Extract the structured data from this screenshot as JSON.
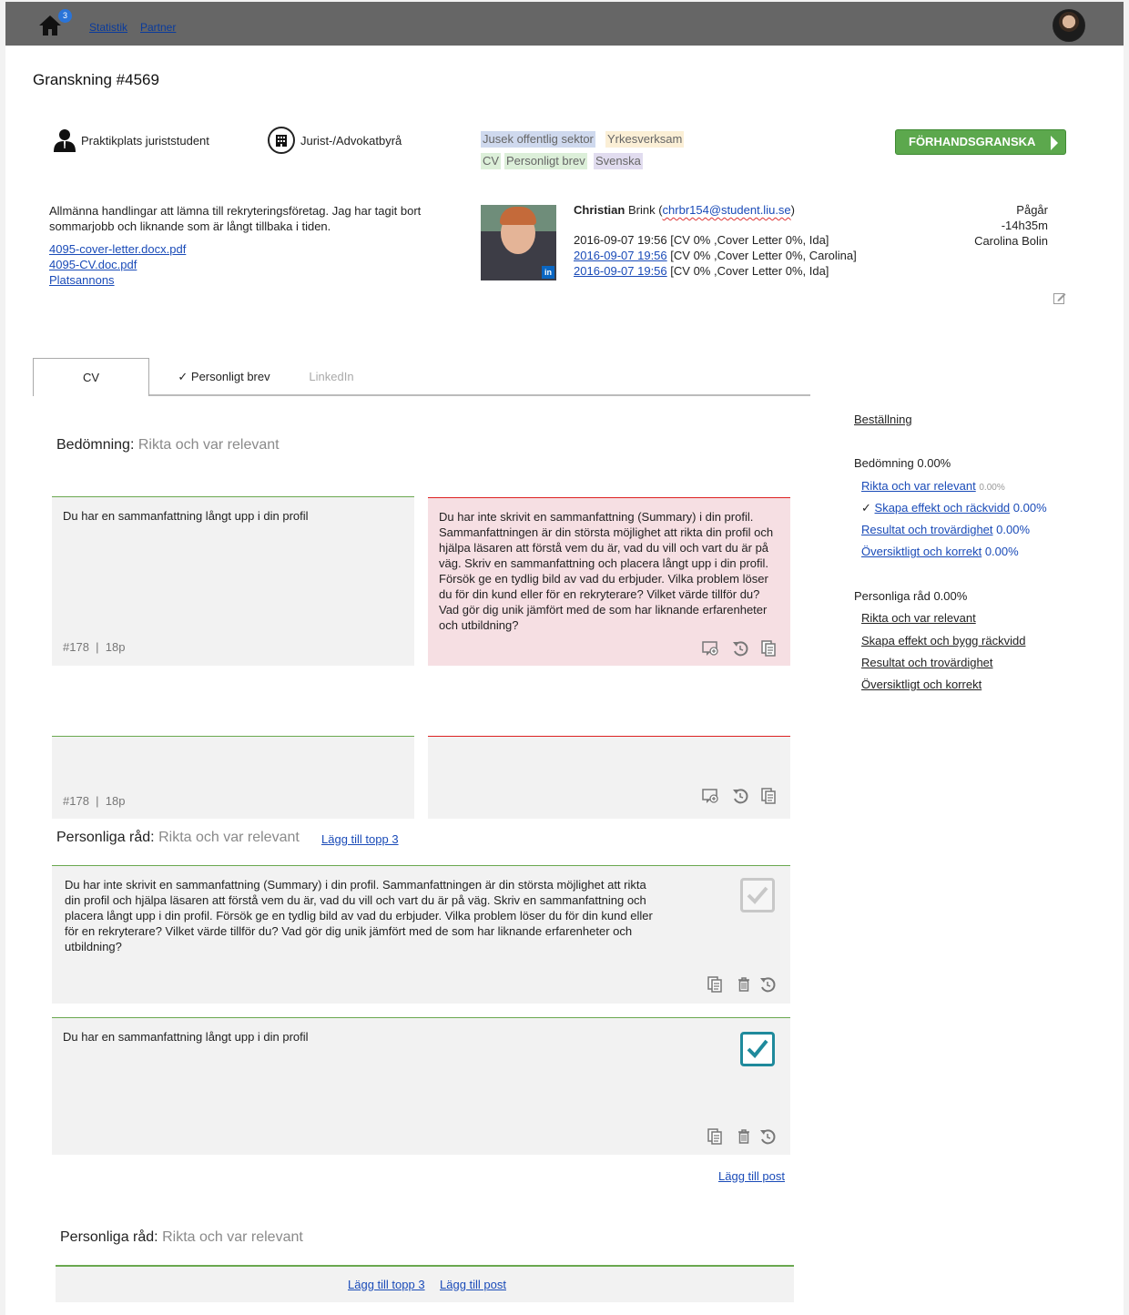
{
  "topbar": {
    "badge_count": "3",
    "nav": [
      "Statistik",
      "Partner"
    ]
  },
  "page_title": "Granskning #4569",
  "info": {
    "position": "Praktikplats juriststudent",
    "industry": "Jurist-/Advokatbyrå",
    "tags": [
      {
        "label": "Jusek offentlig sektor",
        "color": "#cfd9ee"
      },
      {
        "label": "Yrkesverksam",
        "color": "#fbefd6"
      },
      {
        "label": "CV",
        "color": "#dcefd9"
      },
      {
        "label": "Personligt brev",
        "color": "#dcefd9"
      },
      {
        "label": "Svenska",
        "color": "#e1dcef"
      }
    ],
    "preview_button": "FÖRHANDSGRANSKA",
    "description": "Allmänna handlingar att lämna till rekryteringsföretag. Jag har tagit bort sommarjobb och liknande som är långt tillbaka i tiden.",
    "files": [
      "4095-cover-letter.docx.pdf",
      "4095-CV.doc.pdf",
      "Platsannons"
    ],
    "candidate": {
      "first_name": "Christian",
      "last_name": "Brink",
      "email": "chrbr154@student.liu.se"
    },
    "history": [
      {
        "date": "2016-09-07 19:56",
        "linked": false,
        "details": "[CV 0% ,Cover Letter 0%, Ida]"
      },
      {
        "date": "2016-09-07 19:56",
        "linked": true,
        "details": "[CV 0% ,Cover Letter 0%, Carolina]"
      },
      {
        "date": "2016-09-07 19:56",
        "linked": true,
        "details": "[CV 0% ,Cover Letter 0%, Ida]"
      }
    ],
    "status": "Pågår",
    "time_left": "-14h35m",
    "reviewer": "Carolina Bolin"
  },
  "tabs": [
    {
      "label": "CV",
      "state": "active"
    },
    {
      "label": "✓ Personligt brev",
      "state": "normal"
    },
    {
      "label": "LinkedIn",
      "state": "disabled"
    }
  ],
  "assessment": {
    "heading": "Bedömning:",
    "category": "Rikta och var relevant",
    "rows": [
      {
        "left_text": "Du har en sammanfattning långt upp i din profil",
        "left_id": "#178",
        "left_points": "18p",
        "right_text": "Du har inte skrivit en sammanfattning (Summary) i din profil. Sammanfattningen är din största möjlighet att rikta din profil och hjälpa läsaren att förstå vem du är, vad du vill och vart du är på väg. Skriv en sammanfattning och placera långt upp i din profil. Försök ge en tydlig bild av vad du erbjuder. Vilka problem löser du för din kund eller för en rekryterare? Vilket värde tillför du? Vad gör dig unik jämfört med de som har liknande erfarenheter och utbildning?"
      },
      {
        "left_text": "",
        "left_id": "#178",
        "left_points": "18p",
        "right_text": ""
      }
    ]
  },
  "advice": {
    "heading": "Personliga råd:",
    "category": "Rikta och var relevant",
    "add_top3": "Lägg till topp 3",
    "items": [
      {
        "text": "Du har inte skrivit en sammanfattning (Summary) i din profil. Sammanfattningen är din största möjlighet att rikta din profil och hjälpa läsaren att förstå vem du är, vad du vill och vart du är på väg. Skriv en sammanfattning och placera långt upp i din profil. Försök ge en tydlig bild av vad du erbjuder. Vilka problem löser du för din kund eller för en rekryterare? Vilket värde tillför du? Vad gör dig unik jämfört med de som har liknande erfarenheter och utbildning?",
        "checked": false
      },
      {
        "text": "Du har en sammanfattning långt upp i din profil",
        "checked": true
      }
    ],
    "add_post": "Lägg till post"
  },
  "advice2": {
    "heading": "Personliga råd:",
    "category": "Rikta och var relevant",
    "add_top3": "Lägg till topp 3",
    "add_post": "Lägg till post"
  },
  "sidebar": {
    "order_link": "Beställning",
    "assessment_title": "Bedömning 0.00%",
    "assessment_items": [
      {
        "label": "Rikta och var relevant",
        "pct": "0.00%",
        "checked": false
      },
      {
        "label": "Skapa effekt och räckvidd",
        "pct": "0.00%",
        "checked": true
      },
      {
        "label": "Resultat och trovärdighet",
        "pct": "0.00%",
        "checked": false
      },
      {
        "label": "Översiktligt och korrekt",
        "pct": "0.00%",
        "checked": false
      }
    ],
    "advice_title": "Personliga råd 0.00%",
    "advice_items": [
      "Rikta och var relevant",
      "Skapa effekt och bygg räckvidd",
      "Resultat och trovärdighet",
      "Översiktligt och korrekt"
    ]
  },
  "icons": {
    "home": "home-icon",
    "person": "person-icon",
    "building": "building-icon",
    "edit": "edit-icon",
    "add_comment": "add-comment-icon",
    "undo": "undo-icon",
    "copy": "copy-icon",
    "trash": "trash-icon",
    "checkbox": "checkbox-icon"
  }
}
